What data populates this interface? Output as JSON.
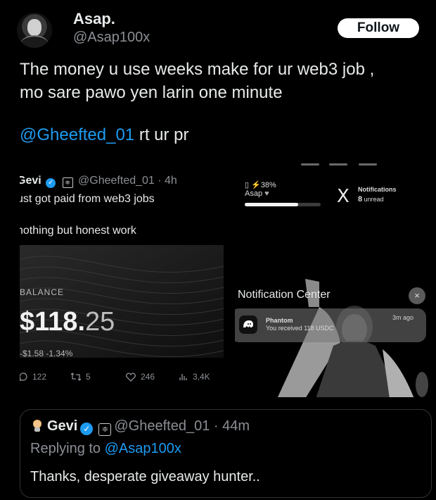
{
  "tweet": {
    "display_name": "Asap.",
    "handle": "@Asap100x",
    "follow_label": "Follow",
    "text_line1": "The money u use weeks make for ur web3  job ,",
    "text_line2": "mo sare pawo yen larin one minute",
    "mention": "@Gheefted_01",
    "mention_suffix": " rt ur pr"
  },
  "embedded": {
    "left": {
      "name": "Gevi",
      "handle_time": "@Gheefted_01 · 4h",
      "text1": "ust got paid from web3 jobs",
      "text2": "nothing but honest work",
      "balance_label": "BALANCE",
      "balance_whole": "$118.",
      "balance_cents": "25",
      "balance_change": "-$1.58  -1.34%",
      "metrics": {
        "replies": "122",
        "retweets": "5",
        "likes": "246",
        "views": "3,4K"
      }
    },
    "right": {
      "battery": "38%",
      "user": "Asap",
      "progress": 0.7,
      "x_logo": "X",
      "notifications_title": "Notifications",
      "notifications_count": "8",
      "notifications_unread": "unread",
      "center_title": "Notification Center",
      "close_icon": "×",
      "app_name": "Phantom",
      "app_message": "You received 118 USDC",
      "app_time": "3m ago"
    }
  },
  "reply": {
    "name": "Gevi",
    "handle_time": "@Gheefted_01 · 44m",
    "replying_prefix": "Replying to ",
    "replying_to": "@Asap100x",
    "text": "Thanks, desperate giveaway hunter.."
  },
  "colors": {
    "accent": "#1d9bf0",
    "muted": "#8b8f94",
    "text": "#e7e9ea"
  }
}
